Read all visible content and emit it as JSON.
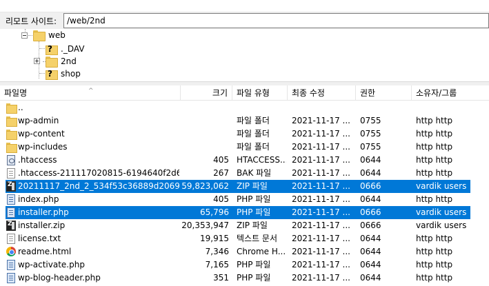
{
  "remote": {
    "label": "리모트 사이트:",
    "path": "/web/2nd"
  },
  "tree": [
    {
      "label": "web",
      "icon": "folder-icon"
    },
    {
      "label": "._DAV",
      "icon": "unknown-folder-icon"
    },
    {
      "label": "2nd",
      "icon": "folder-icon"
    },
    {
      "label": "shop",
      "icon": "unknown-folder-icon"
    }
  ],
  "columns": {
    "name": "파일명",
    "size": "크기",
    "type": "파일 유형",
    "modified": "최종 수정",
    "perms": "권한",
    "owner": "소유자/그룹"
  },
  "files": [
    {
      "name": "..",
      "size": "",
      "type": "",
      "modified": "",
      "perms": "",
      "owner": "",
      "icon": "folder-icon",
      "selected": false
    },
    {
      "name": "wp-admin",
      "size": "",
      "type": "파일 폴더",
      "modified": "2021-11-17 ...",
      "perms": "0755",
      "owner": "http http",
      "icon": "folder-icon",
      "selected": false
    },
    {
      "name": "wp-content",
      "size": "",
      "type": "파일 폴더",
      "modified": "2021-11-17 ...",
      "perms": "0755",
      "owner": "http http",
      "icon": "folder-icon",
      "selected": false
    },
    {
      "name": "wp-includes",
      "size": "",
      "type": "파일 폴더",
      "modified": "2021-11-17 ...",
      "perms": "0755",
      "owner": "http http",
      "icon": "folder-icon",
      "selected": false
    },
    {
      "name": ".htaccess",
      "size": "405",
      "type": "HTACCESS...",
      "modified": "2021-11-17 ...",
      "perms": "0644",
      "owner": "http http",
      "icon": "gear-file-icon",
      "selected": false
    },
    {
      "name": ".htaccess-211117020815-6194640f2d6c...",
      "size": "267",
      "type": "BAK 파일",
      "modified": "2021-11-17 ...",
      "perms": "0644",
      "owner": "http http",
      "icon": "file-icon",
      "selected": false
    },
    {
      "name": "20211117_2nd_2_534f53c36889d20694...",
      "size": "59,823,062",
      "type": "ZIP 파일",
      "modified": "2021-11-17 ...",
      "perms": "0666",
      "owner": "vardik users",
      "icon": "zip-icon",
      "selected": true
    },
    {
      "name": "index.php",
      "size": "405",
      "type": "PHP 파일",
      "modified": "2021-11-17 ...",
      "perms": "0644",
      "owner": "http http",
      "icon": "php-file-icon",
      "selected": false
    },
    {
      "name": "installer.php",
      "size": "65,796",
      "type": "PHP 파일",
      "modified": "2021-11-17 ...",
      "perms": "0666",
      "owner": "vardik users",
      "icon": "php-file-icon",
      "selected": true
    },
    {
      "name": "installer.zip",
      "size": "20,353,947",
      "type": "ZIP 파일",
      "modified": "2021-11-17 ...",
      "perms": "0666",
      "owner": "vardik users",
      "icon": "zip-icon",
      "selected": false
    },
    {
      "name": "license.txt",
      "size": "19,915",
      "type": "텍스트 문서",
      "modified": "2021-11-17 ...",
      "perms": "0644",
      "owner": "http http",
      "icon": "file-icon",
      "selected": false
    },
    {
      "name": "readme.html",
      "size": "7,346",
      "type": "Chrome H...",
      "modified": "2021-11-17 ...",
      "perms": "0644",
      "owner": "http http",
      "icon": "chrome-icon",
      "selected": false
    },
    {
      "name": "wp-activate.php",
      "size": "7,165",
      "type": "PHP 파일",
      "modified": "2021-11-17 ...",
      "perms": "0644",
      "owner": "http http",
      "icon": "php-file-icon",
      "selected": false
    },
    {
      "name": "wp-blog-header.php",
      "size": "351",
      "type": "PHP 파일",
      "modified": "2021-11-17 ...",
      "perms": "0644",
      "owner": "http http",
      "icon": "php-file-icon",
      "selected": false
    }
  ],
  "colors": {
    "selection": "#0078d7",
    "folder": "#f5d16a"
  }
}
